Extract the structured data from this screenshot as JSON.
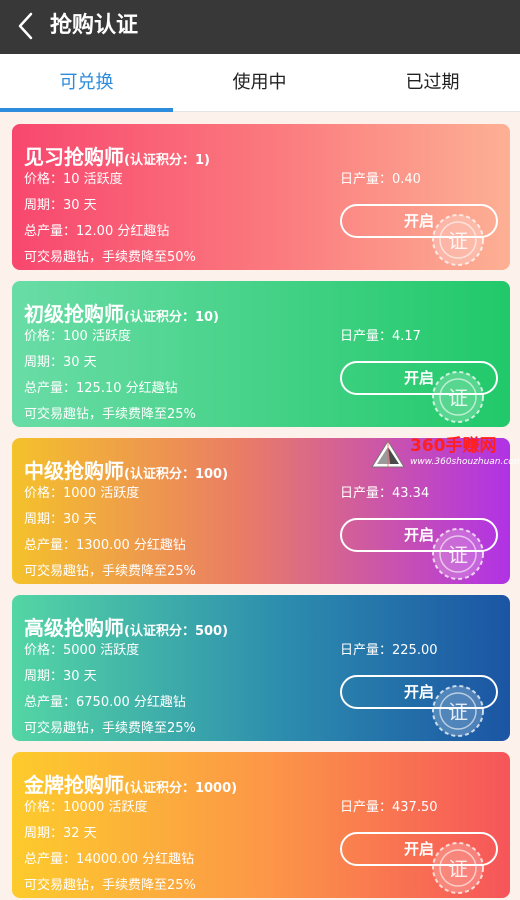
{
  "header": {
    "title": "抢购认证",
    "back_icon": "chevron-left-icon"
  },
  "tabs": [
    {
      "label": "可兑换",
      "active": true
    },
    {
      "label": "使用中",
      "active": false
    },
    {
      "label": "已过期",
      "active": false
    }
  ],
  "cards": [
    {
      "name": "见习抢购师",
      "score": "(认证积分：1)",
      "price": "价格：10 活跃度",
      "period": "周期：30 天",
      "total": "总产量：12.00 分红趣钻",
      "note": "可交易趣钻，手续费降至50%",
      "daily": "日产量：0.40",
      "button": "开启",
      "stamp": "证"
    },
    {
      "name": "初级抢购师",
      "score": "(认证积分：10)",
      "price": "价格：100 活跃度",
      "period": "周期：30 天",
      "total": "总产量：125.10 分红趣钻",
      "note": "可交易趣钻，手续费降至25%",
      "daily": "日产量：4.17",
      "button": "开启",
      "stamp": "证"
    },
    {
      "name": "中级抢购师",
      "score": "(认证积分：100)",
      "price": "价格：1000 活跃度",
      "period": "周期：30 天",
      "total": "总产量：1300.00 分红趣钻",
      "note": "可交易趣钻，手续费降至25%",
      "daily": "日产量：43.34",
      "button": "开启",
      "stamp": "证"
    },
    {
      "name": "高级抢购师",
      "score": "(认证积分：500)",
      "price": "价格：5000 活跃度",
      "period": "周期：30 天",
      "total": "总产量：6750.00 分红趣钻",
      "note": "可交易趣钻，手续费降至25%",
      "daily": "日产量：225.00",
      "button": "开启",
      "stamp": "证"
    },
    {
      "name": "金牌抢购师",
      "score": "(认证积分：1000)",
      "price": "价格：10000 活跃度",
      "period": "周期：32 天",
      "total": "总产量：14000.00 分红趣钻",
      "note": "可交易趣钻，手续费降至25%",
      "daily": "日产量：437.50",
      "button": "开启",
      "stamp": "证"
    }
  ],
  "watermark": {
    "name": "360手赚网",
    "url": "www.360shouzhuan.com"
  },
  "colors": {
    "header_bg": "#383838",
    "tab_active": "#2d8ddc",
    "page_bg": "#fdf1ec"
  }
}
